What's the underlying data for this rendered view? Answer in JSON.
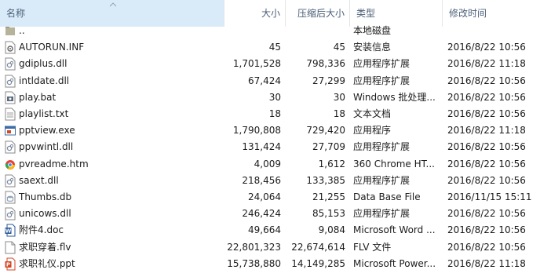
{
  "columns": {
    "name": "名称",
    "size": "大小",
    "compressed": "压缩后大小",
    "type": "类型",
    "modified": "修改时间"
  },
  "sort_icon": "sort-ascending-icon",
  "rows": [
    {
      "icon": "folder-up-icon",
      "name": "..",
      "size": "",
      "compressed": "",
      "type": "本地磁盘",
      "modified": ""
    },
    {
      "icon": "settings-file-icon",
      "name": "AUTORUN.INF",
      "size": "45",
      "compressed": "45",
      "type": "安装信息",
      "modified": "2016/8/22 10:56"
    },
    {
      "icon": "dll-file-icon",
      "name": "gdiplus.dll",
      "size": "1,701,528",
      "compressed": "798,336",
      "type": "应用程序扩展",
      "modified": "2016/8/22 11:18"
    },
    {
      "icon": "dll-file-icon",
      "name": "intldate.dll",
      "size": "67,424",
      "compressed": "27,299",
      "type": "应用程序扩展",
      "modified": "2016/8/22 10:56"
    },
    {
      "icon": "batch-file-icon",
      "name": "play.bat",
      "size": "30",
      "compressed": "30",
      "type": "Windows 批处理...",
      "modified": "2016/8/22 10:56"
    },
    {
      "icon": "text-file-icon",
      "name": "playlist.txt",
      "size": "18",
      "compressed": "18",
      "type": "文本文档",
      "modified": "2016/8/22 10:56"
    },
    {
      "icon": "exe-file-icon",
      "name": "pptview.exe",
      "size": "1,790,808",
      "compressed": "729,420",
      "type": "应用程序",
      "modified": "2016/8/22 11:18"
    },
    {
      "icon": "dll-file-icon",
      "name": "ppvwintl.dll",
      "size": "131,424",
      "compressed": "27,709",
      "type": "应用程序扩展",
      "modified": "2016/8/22 10:56"
    },
    {
      "icon": "chrome-html-icon",
      "name": "pvreadme.htm",
      "size": "4,009",
      "compressed": "1,612",
      "type": "360 Chrome HT...",
      "modified": "2016/8/22 10:56"
    },
    {
      "icon": "dll-file-icon",
      "name": "saext.dll",
      "size": "218,456",
      "compressed": "133,385",
      "type": "应用程序扩展",
      "modified": "2016/8/22 10:56"
    },
    {
      "icon": "database-file-icon",
      "name": "Thumbs.db",
      "size": "24,064",
      "compressed": "21,255",
      "type": "Data Base File",
      "modified": "2016/11/15 15:11"
    },
    {
      "icon": "dll-file-icon",
      "name": "unicows.dll",
      "size": "246,424",
      "compressed": "85,153",
      "type": "应用程序扩展",
      "modified": "2016/8/22 10:56"
    },
    {
      "icon": "word-doc-icon",
      "name": "附件4.doc",
      "size": "49,664",
      "compressed": "9,084",
      "type": "Microsoft Word ...",
      "modified": "2016/8/22 10:56"
    },
    {
      "icon": "blank-file-icon",
      "name": "求职穿着.flv",
      "size": "22,801,323",
      "compressed": "22,674,614",
      "type": "FLV 文件",
      "modified": "2016/8/22 10:56"
    },
    {
      "icon": "powerpoint-file-icon",
      "name": "求职礼仪.ppt",
      "size": "15,738,880",
      "compressed": "14,149,285",
      "type": "Microsoft Power...",
      "modified": "2016/8/22 11:18"
    }
  ],
  "colors": {
    "header_text": "#4c607a",
    "text": "#1b1b1b",
    "hover": "#e5f3ff",
    "divider": "#e5e5e5"
  }
}
